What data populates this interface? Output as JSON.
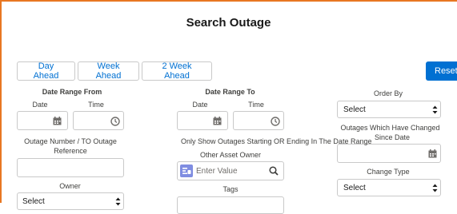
{
  "page": {
    "title": "Search Outage"
  },
  "buttons": {
    "day_ahead": "Day Ahead",
    "week_ahead": "Week Ahead",
    "two_week_ahead": "2 Week Ahead",
    "reset": "Reset"
  },
  "date_range_from": {
    "heading": "Date Range From",
    "date_label": "Date",
    "time_label": "Time"
  },
  "date_range_to": {
    "heading": "Date Range To",
    "date_label": "Date",
    "time_label": "Time"
  },
  "order_by": {
    "label": "Order By",
    "value": "Select"
  },
  "outages_changed": {
    "label_line1": "Outages Which Have Changed",
    "label_line2": "Since Date"
  },
  "outage_number": {
    "label_line1": "Outage Number / TO Outage",
    "label_line2": "Reference"
  },
  "only_show_note": "Only Show Outages Starting OR Ending In The Date Range",
  "other_asset_owner": {
    "label": "Other Asset Owner",
    "placeholder": "Enter Value"
  },
  "change_type": {
    "label": "Change Type",
    "value": "Select"
  },
  "owner": {
    "label": "Owner",
    "value": "Select"
  },
  "tags": {
    "label": "Tags"
  },
  "colors": {
    "accent": "#0070d2",
    "frame": "#e87722",
    "border": "#c9c9c9"
  },
  "icons": [
    "calendar-icon",
    "clock-icon",
    "search-icon",
    "chevron-updown-icon",
    "record-icon"
  ]
}
